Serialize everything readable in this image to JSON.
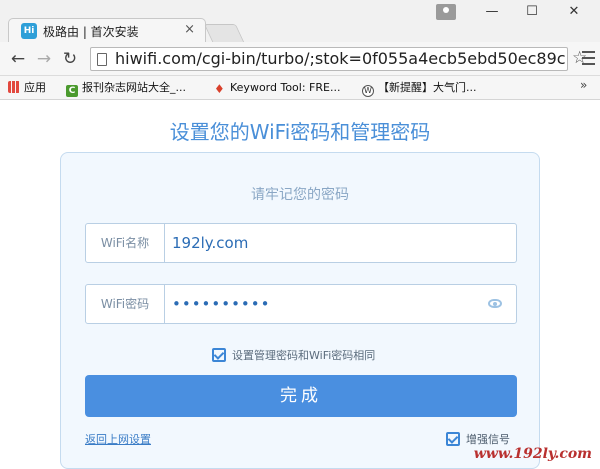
{
  "browser": {
    "tab_title": "极路由 | 首次安装",
    "favicon_text": "Hi",
    "tab_close": "×",
    "url": "hiwifi.com/cgi-bin/turbo/;stok=0f055a4ecb5ebd50ec89c",
    "window_controls": {
      "minimize": "—",
      "maximize": "☐",
      "close": "✕"
    },
    "bookmarks": [
      {
        "label": "应用",
        "icon": "apps-grid-icon"
      },
      {
        "label": "报刊杂志网站大全_...",
        "icon": "c-icon"
      },
      {
        "label": "Keyword Tool: FRE...",
        "icon": "flame-icon"
      },
      {
        "label": "【新提醒】大气门...",
        "icon": "wordpress-icon"
      }
    ],
    "bookmarks_more": "»"
  },
  "page": {
    "heading": "设置您的WiFi密码和管理密码",
    "subtitle": "请牢记您的密码",
    "ssid": {
      "label": "WiFi名称",
      "value": "192ly.com"
    },
    "password": {
      "label": "WiFi密码",
      "value": "••••••••••"
    },
    "sync_checkbox_label": "设置管理密码和WiFi密码相同",
    "submit_label": "完成",
    "back_link": "返回上网设置",
    "boost_label": "增强信号"
  },
  "watermark": "www.192ly.com",
  "colors": {
    "accent": "#4a8fe0",
    "heading": "#4a8fd8",
    "card_bg": "#f2f8fe",
    "watermark": "#b9302f"
  }
}
